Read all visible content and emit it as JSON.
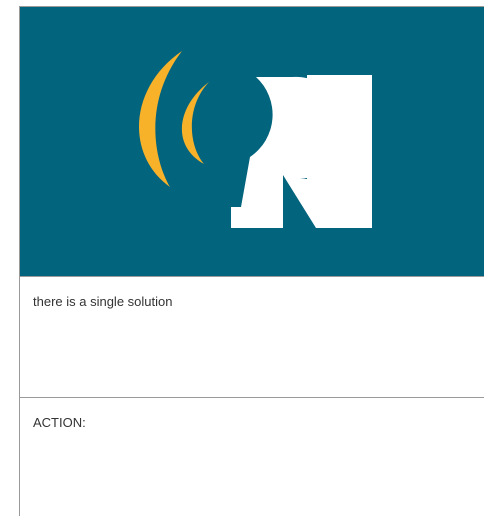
{
  "logo": {
    "icon": "on-radio-signal-logo-icon",
    "colors": {
      "background": "#03647D",
      "arc": "#F7B22A",
      "letter": "#FFFFFF"
    }
  },
  "message": {
    "text": "there is a single solution"
  },
  "action": {
    "label": "ACTION:"
  }
}
